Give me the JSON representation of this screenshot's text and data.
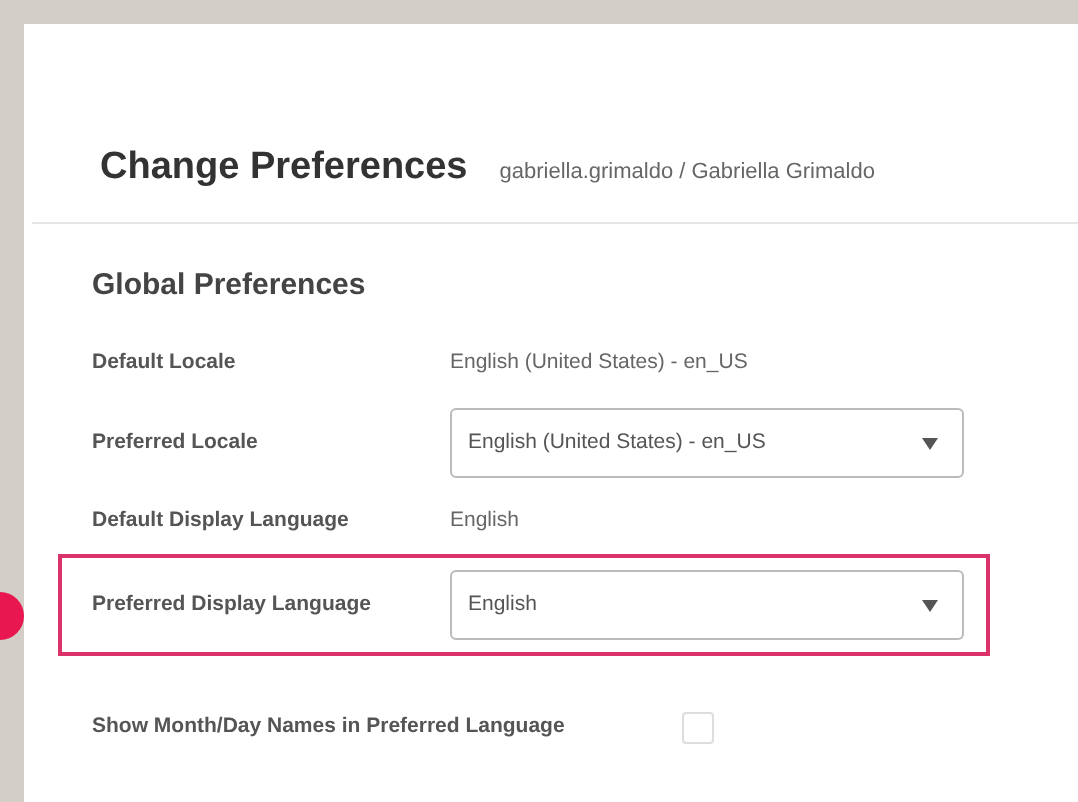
{
  "header": {
    "title": "Change Preferences",
    "user": "gabriella.grimaldo / Gabriella Grimaldo"
  },
  "section_title": "Global Preferences",
  "fields": [
    {
      "kind": "text",
      "label": "Default Locale",
      "value": "English (United States) - en_US",
      "highlighted": false
    },
    {
      "kind": "select",
      "label": "Preferred Locale",
      "value": "English (United States) - en_US",
      "highlighted": false
    },
    {
      "kind": "text",
      "label": "Default Display Language",
      "value": "English",
      "highlighted": false
    },
    {
      "kind": "select",
      "label": "Preferred Display Language",
      "value": "English",
      "highlighted": true
    },
    {
      "kind": "checkbox",
      "label": "Show Month/Day Names in Preferred Language",
      "checked": false,
      "highlighted": false
    }
  ]
}
